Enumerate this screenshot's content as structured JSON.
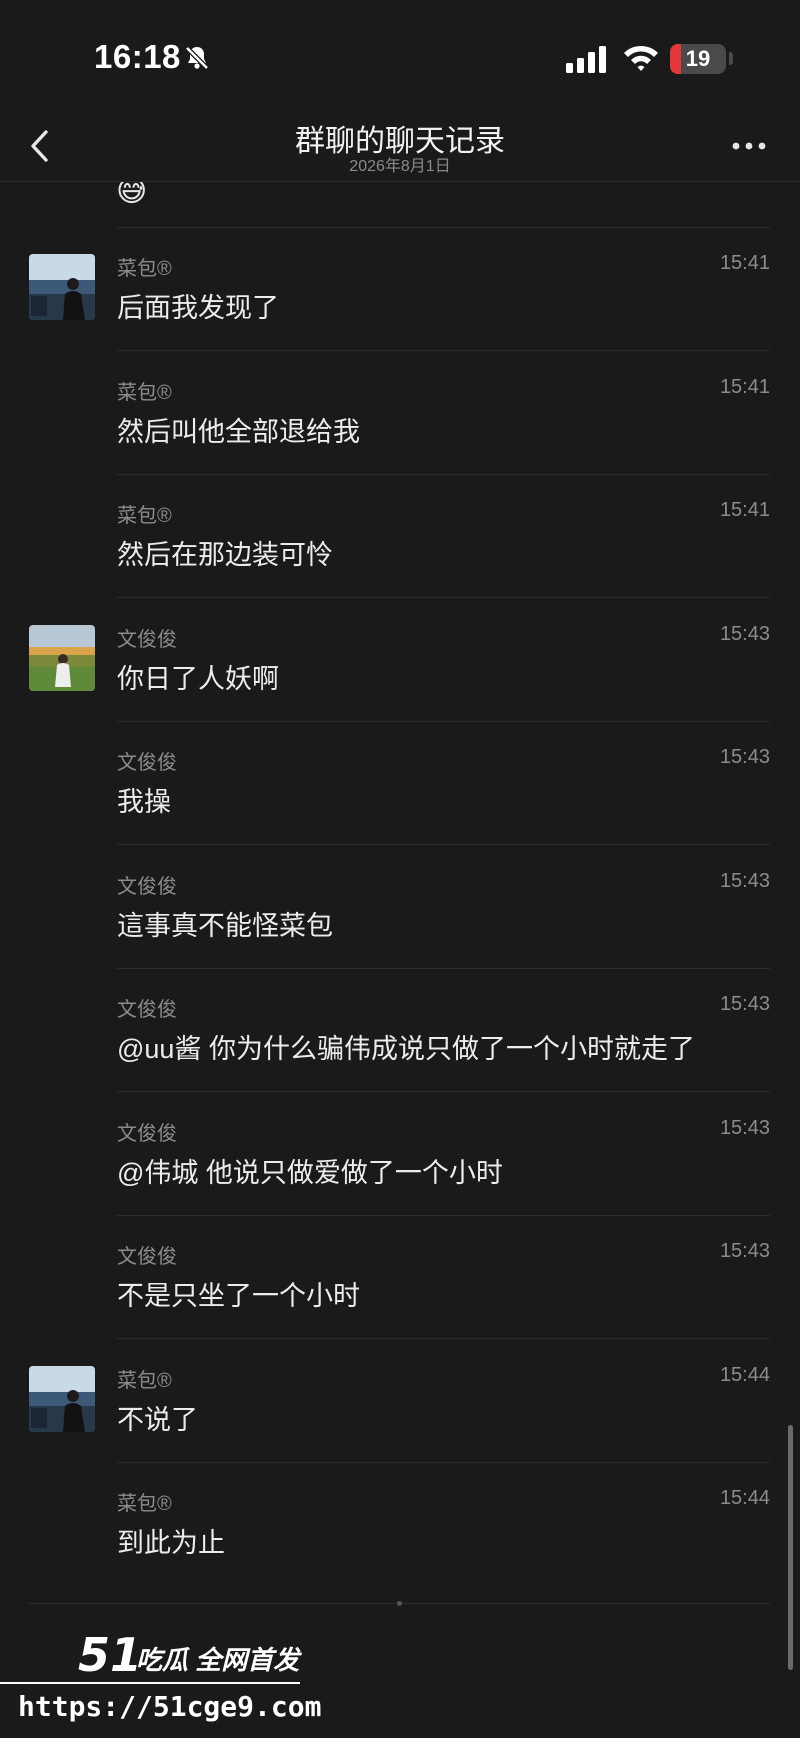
{
  "status_bar": {
    "time": "16:18",
    "battery": "19",
    "battery_level_percent": 19,
    "battery_color": "#e5373a"
  },
  "nav": {
    "title": "群聊的聊天记录",
    "subtitle": "2026年8月1日"
  },
  "top_emoji": "😅",
  "messages": [
    {
      "sender": "菜包®",
      "time": "15:41",
      "text": "后面我发现了",
      "avatar": "caibao"
    },
    {
      "sender": "菜包®",
      "time": "15:41",
      "text": "然后叫他全部退给我"
    },
    {
      "sender": "菜包®",
      "time": "15:41",
      "text": "然后在那边装可怜"
    },
    {
      "sender": "文俊俊",
      "time": "15:43",
      "text": "你日了人妖啊",
      "avatar": "wenjunjun"
    },
    {
      "sender": "文俊俊",
      "time": "15:43",
      "text": "我操"
    },
    {
      "sender": "文俊俊",
      "time": "15:43",
      "text": "這事真不能怪菜包"
    },
    {
      "sender": "文俊俊",
      "time": "15:43",
      "text": "@uu酱 你为什么骗伟成说只做了一个小时就走了"
    },
    {
      "sender": "文俊俊",
      "time": "15:43",
      "text": "@伟城 他说只做爱做了一个小时"
    },
    {
      "sender": "文俊俊",
      "time": "15:43",
      "text": "不是只坐了一个小时"
    },
    {
      "sender": "菜包®",
      "time": "15:44",
      "text": "不说了",
      "avatar": "caibao"
    },
    {
      "sender": "菜包®",
      "time": "15:44",
      "text": "到此为止"
    }
  ],
  "watermark": {
    "logo_number": "51",
    "tagline": "吃瓜 全网首发",
    "url": "https://51cge9.com"
  }
}
